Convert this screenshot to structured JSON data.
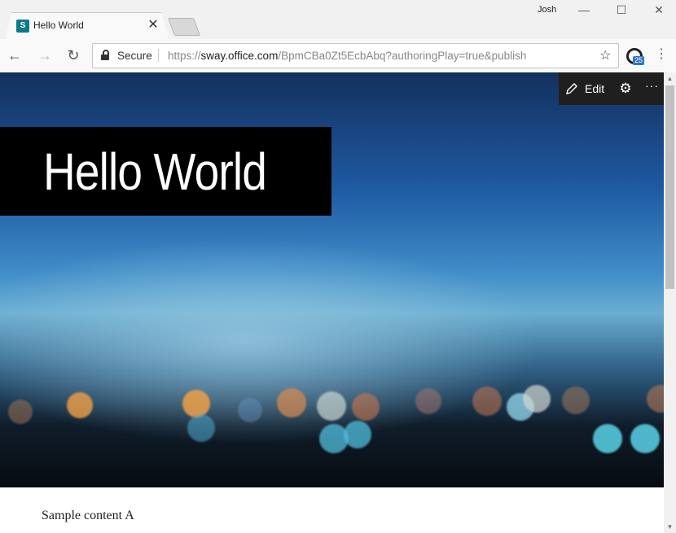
{
  "browser": {
    "tab": {
      "title": "Hello World",
      "favicon": "sway-icon",
      "close": "✕"
    },
    "user": "Josh",
    "window_controls": {
      "minimize": "—",
      "maximize": "☐",
      "close": "✕"
    },
    "nav": {
      "back": "←",
      "forward": "→",
      "reload": "↻"
    },
    "address": {
      "secure_label": "Secure",
      "scheme": "https://",
      "host": "sway.office.com",
      "path": "/BpmCBa0Zt5EcbAbq?authoringPlay=true&publish"
    },
    "bookmark_star": "☆",
    "extension_badge": "25",
    "menu": "⋮"
  },
  "sway": {
    "toolbar": {
      "edit_label": "Edit",
      "settings": "⚙",
      "more": "···"
    },
    "title": "Hello World",
    "content_text": "Sample content A"
  },
  "colors": {
    "accent": "#2d76c4",
    "title_box": "#000000",
    "toolbar_dark": "#1f1f1f"
  }
}
